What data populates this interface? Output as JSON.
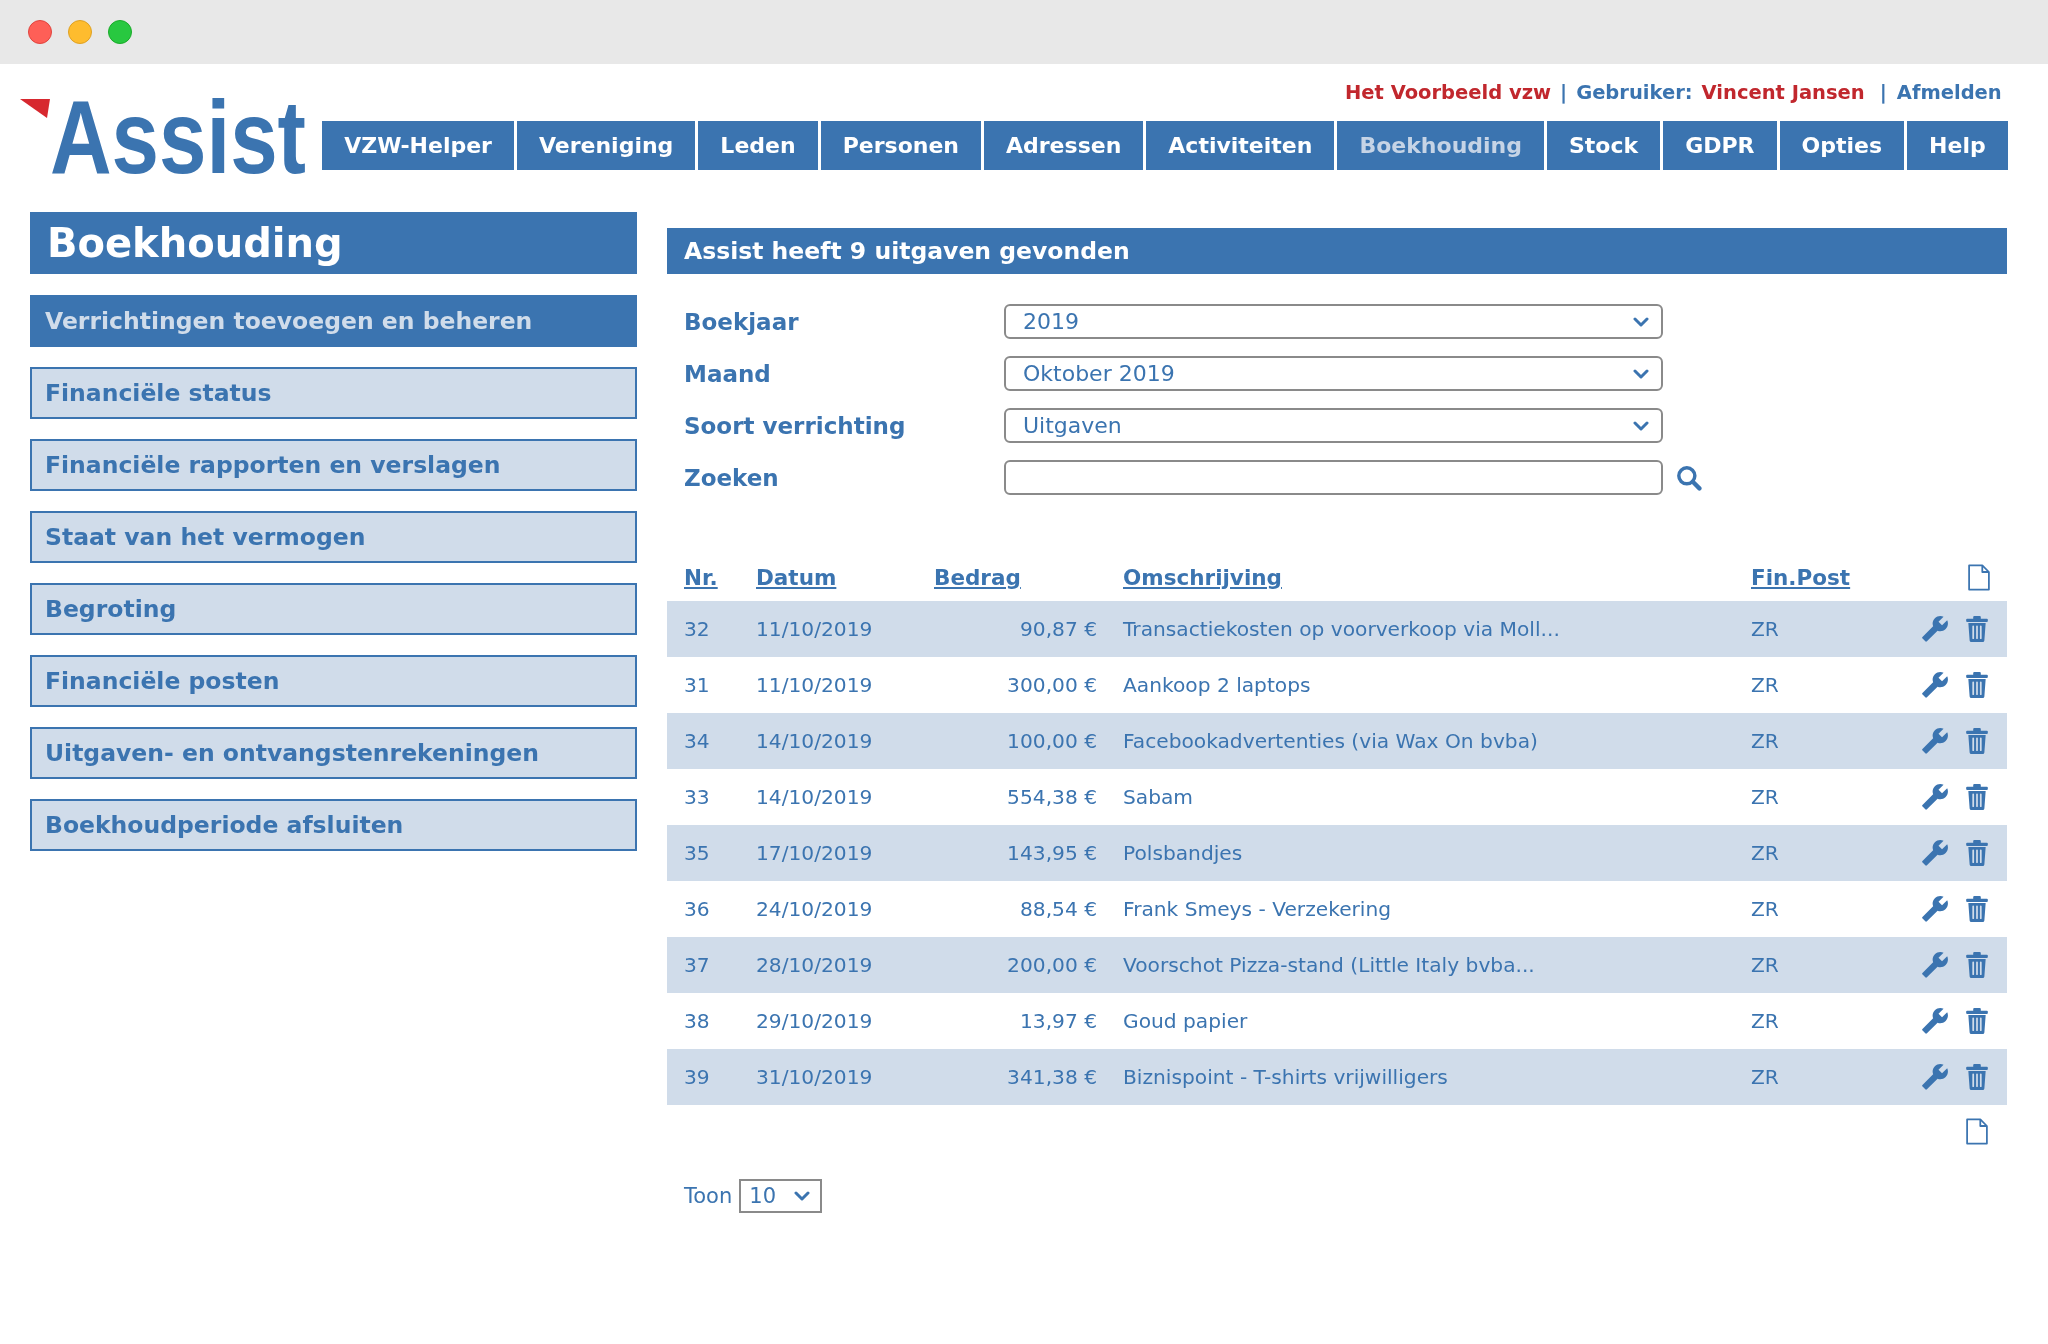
{
  "logo": {
    "text": "Assist"
  },
  "user_bar": [
    {
      "kind": "organization",
      "text": "Het Voorbeeld vzw"
    },
    {
      "kind": "separator",
      "text": "|"
    },
    {
      "kind": "label",
      "text": "Gebruiker:"
    },
    {
      "kind": "user",
      "text": "Vincent Jansen"
    },
    {
      "kind": "separator",
      "text": "|"
    },
    {
      "kind": "link",
      "text": "Afmelden"
    }
  ],
  "nav": {
    "tabs": [
      {
        "label": "VZW-Helper",
        "selected": false
      },
      {
        "label": "Vereniging",
        "selected": false
      },
      {
        "label": "Leden",
        "selected": false
      },
      {
        "label": "Personen",
        "selected": false
      },
      {
        "label": "Adressen",
        "selected": false
      },
      {
        "label": "Activiteiten",
        "selected": false
      },
      {
        "label": "Boekhouding",
        "selected": true
      },
      {
        "label": "Stock",
        "selected": false
      },
      {
        "label": "GDPR",
        "selected": false
      },
      {
        "label": "Opties",
        "selected": false
      },
      {
        "label": "Help",
        "selected": false
      }
    ]
  },
  "sidebar": {
    "title": "Boekhouding",
    "items": [
      {
        "label": "Verrichtingen toevoegen en beheren",
        "selected": true
      },
      {
        "label": "Financiële status",
        "selected": false
      },
      {
        "label": "Financiële rapporten en verslagen",
        "selected": false
      },
      {
        "label": "Staat van het vermogen",
        "selected": false
      },
      {
        "label": "Begroting",
        "selected": false
      },
      {
        "label": "Financiële posten",
        "selected": false
      },
      {
        "label": "Uitgaven- en ontvangstenrekeningen",
        "selected": false
      },
      {
        "label": "Boekhoudperiode afsluiten",
        "selected": false
      }
    ]
  },
  "results": {
    "title": "Assist heeft 9 uitgaven gevonden",
    "filters": [
      {
        "kind": "select",
        "label": "Boekjaar",
        "value": "2019"
      },
      {
        "kind": "select",
        "label": "Maand",
        "value": "Oktober 2019"
      },
      {
        "kind": "select",
        "label": "Soort verrichting",
        "value": "Uitgaven"
      },
      {
        "kind": "search",
        "label": "Zoeken"
      }
    ],
    "table": {
      "columns": [
        "Nr.",
        "Datum",
        "Bedrag",
        "Omschrijving",
        "Fin.Post"
      ],
      "rows": [
        {
          "cells": [
            "32",
            "11/10/2019",
            "90,87 €",
            "Transactiekosten op voorverkoop via Moll...",
            "ZR"
          ]
        },
        {
          "cells": [
            "31",
            "11/10/2019",
            "300,00 €",
            "Aankoop 2 laptops",
            "ZR"
          ]
        },
        {
          "cells": [
            "34",
            "14/10/2019",
            "100,00 €",
            "Facebookadvertenties (via Wax On bvba)",
            "ZR"
          ]
        },
        {
          "cells": [
            "33",
            "14/10/2019",
            "554,38 €",
            "Sabam",
            "ZR"
          ]
        },
        {
          "cells": [
            "35",
            "17/10/2019",
            "143,95 €",
            "Polsbandjes",
            "ZR"
          ]
        },
        {
          "cells": [
            "36",
            "24/10/2019",
            "88,54 €",
            "Frank Smeys - Verzekering",
            "ZR"
          ]
        },
        {
          "cells": [
            "37",
            "28/10/2019",
            "200,00 €",
            "Voorschot Pizza-stand (Little Italy bvba...",
            "ZR"
          ]
        },
        {
          "cells": [
            "38",
            "29/10/2019",
            "13,97 €",
            "Goud papier",
            "ZR"
          ]
        },
        {
          "cells": [
            "39",
            "31/10/2019",
            "341,38 €",
            "Biznispoint - T-shirts vrijwilligers",
            "ZR"
          ]
        }
      ]
    },
    "page_size": {
      "label": "Toon",
      "value": "10"
    }
  }
}
